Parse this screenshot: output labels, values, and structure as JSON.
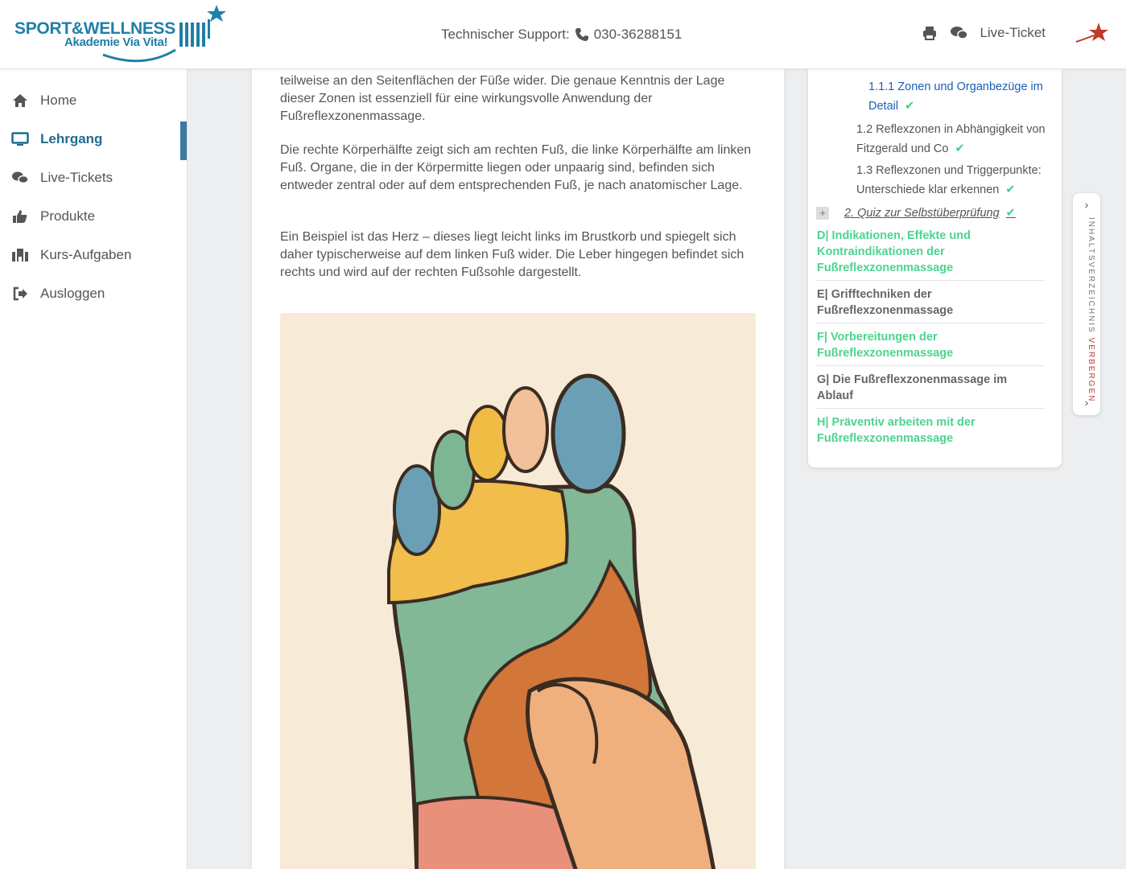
{
  "header": {
    "logo_line1": "SPORT&WELLNESS",
    "logo_line2": "Akademie Via Vita!",
    "support_label": "Technischer Support:",
    "support_phone": "030-36288151",
    "live_ticket_label": "Live-Ticket",
    "brand_color": "#1f7fa8"
  },
  "sidebar": {
    "items": [
      {
        "label": "Home",
        "icon": "home-icon"
      },
      {
        "label": "Lehrgang",
        "icon": "monitor-icon",
        "active": true
      },
      {
        "label": "Live-Tickets",
        "icon": "chat-icon"
      },
      {
        "label": "Produkte",
        "icon": "thumbs-up-icon"
      },
      {
        "label": "Kurs-Aufgaben",
        "icon": "institution-icon"
      },
      {
        "label": "Ausloggen",
        "icon": "logout-icon"
      }
    ],
    "active_color": "#1f6c92"
  },
  "content": {
    "p1": "teilweise an den Seitenflächen der Füße wider. Die genaue Kenntnis der Lage dieser Zonen ist essenziell für eine wirkungsvolle Anwendung der Fußreflexzonenmassage.",
    "p2": "Die rechte Körperhälfte zeigt sich am rechten Fuß, die linke Körperhälfte am linken Fuß. Organe, die in der Körpermitte liegen oder unpaarig sind, befinden sich entweder zentral oder auf dem entsprechenden Fuß, je nach anatomischer Lage.",
    "p3": "Ein Beispiel ist das Herz – dieses liegt leicht links im Brustkorb und spiegelt sich daher typischerweise auf dem linken Fuß wider. Die Leber hingegen befindet sich rechts und wird auf der rechten Fußsohle dargestellt."
  },
  "toc": {
    "item_111": "1.1.1 Zonen und Organbezüge im Detail",
    "item_12": "1.2 Reflexzonen in Abhängigkeit von Fitzgerald und Co",
    "item_13": "1.3 Reflexzonen und Triggerpunkte: Unterschiede klar erkennen",
    "quiz": "2. Quiz zur Selbstüberprüfung",
    "sec_d": "D| Indikationen, Effekte und Kontraindikationen der Fußreflexzonenmassage",
    "sec_e": "E| Grifftechniken der Fußreflexzonenmassage",
    "sec_f": "F| Vorbereitungen der Fußreflexzonenmassage",
    "sec_g": "G| Die Fußreflexzonenmassage im Ablauf",
    "sec_h": "H| Präventiv arbeiten mit der Fußreflexzonenmassage",
    "done_color": "#4cd48e",
    "link_color": "#1a5fb4"
  },
  "sidetab": {
    "label_main": "INHALTSVERZEICHNIS ",
    "label_action": "VERBERGEN"
  }
}
